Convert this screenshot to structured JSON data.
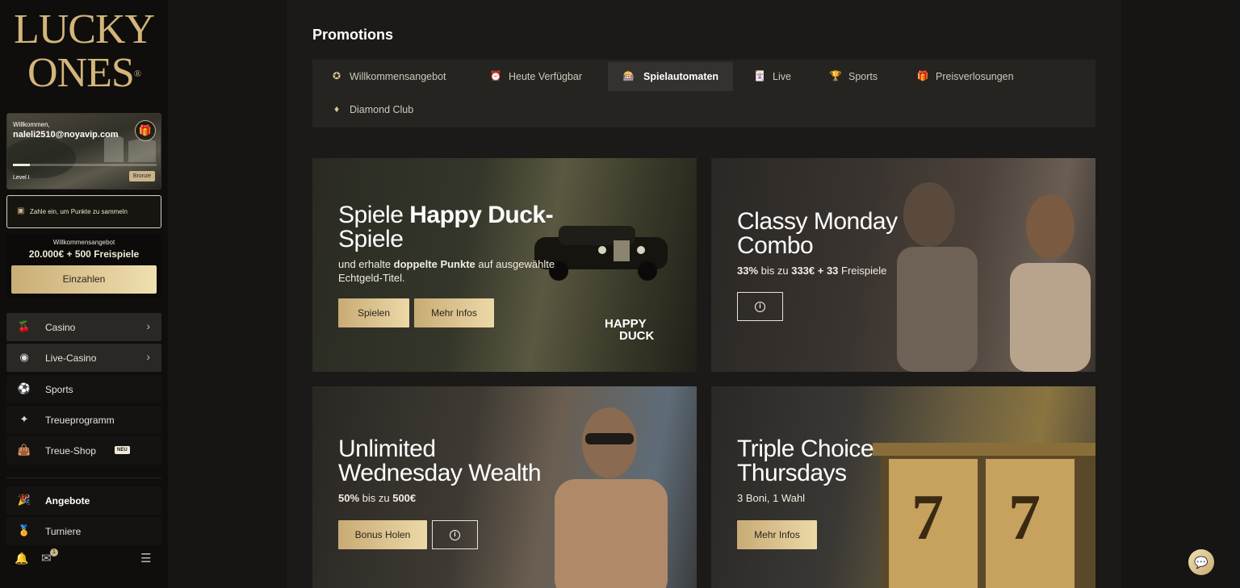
{
  "sidebar": {
    "logo_line1": "LUCKY",
    "logo_line2": "ONES",
    "logo_mark": "®",
    "profile": {
      "welcome": "Willkommen,",
      "email": "naleli2510@noyavip.com",
      "level": "Level I",
      "badge": "Bronze",
      "progress": 0.12,
      "gift_icon": "gift-icon"
    },
    "points_text": "Zahle ein, um Punkte zu sammeln",
    "offer": {
      "title": "Willkommensangebot",
      "value": "20.000€ + 500 Freispiele",
      "button": "Einzahlen"
    },
    "nav": [
      {
        "label": "Casino",
        "icon": "cherry-icon"
      },
      {
        "label": "Live-Casino",
        "icon": "chip-icon"
      },
      {
        "label": "Sports",
        "icon": "football-icon"
      },
      {
        "label": "Treueprogramm",
        "icon": "sparkle-icon"
      },
      {
        "label": "Treue-Shop",
        "icon": "shopping-bag-icon",
        "badge": "NEU"
      },
      {
        "label": "Angebote",
        "icon": "party-popper-icon"
      },
      {
        "label": "Turniere",
        "icon": "medal-icon"
      }
    ],
    "mail_count": "1"
  },
  "main": {
    "title": "Promotions",
    "tabs": [
      {
        "label": "Willkommensangebot",
        "icon": "percent-badge-icon"
      },
      {
        "label": "Heute Verfügbar",
        "icon": "alarm-clock-icon"
      },
      {
        "label": "Spielautomaten",
        "icon": "slot-machine-icon"
      },
      {
        "label": "Live",
        "icon": "cards-icon"
      },
      {
        "label": "Sports",
        "icon": "trophy-icon"
      },
      {
        "label": "Preisverlosungen",
        "icon": "gift-icon"
      },
      {
        "label": "Diamond Club",
        "icon": "diamond-icon"
      }
    ],
    "cards": [
      {
        "title_pre": "Spiele ",
        "title_bold": "Happy Duck-",
        "title_line2": "Spiele",
        "desc_pre": "und erhalte ",
        "desc_bold": "doppelte Punkte",
        "desc_post": " auf ausgewählte",
        "desc_line2": "Echtgeld-Titel.",
        "btn1": "Spielen",
        "btn2": "Mehr Infos",
        "brand_line1": "HAPPY",
        "brand_line2": "DUCK"
      },
      {
        "title_line1": "Classy Monday",
        "title_line2": "Combo",
        "desc_b1": "33%",
        "desc_t1": " bis zu ",
        "desc_b2": "333€ + 33",
        "desc_t2": " Freispiele",
        "info": "i"
      },
      {
        "title_line1": "Unlimited",
        "title_line2": "Wednesday Wealth",
        "desc_b1": "50%",
        "desc_t1": " bis zu ",
        "desc_b2": "500€",
        "btn1": "Bonus Holen",
        "info": "i"
      },
      {
        "title_line1": "Triple Choice",
        "title_line2": "Thursdays",
        "desc": "3 Boni, 1 Wahl",
        "btn1": "Mehr Infos",
        "reel1": "7",
        "reel2": "7"
      }
    ]
  }
}
